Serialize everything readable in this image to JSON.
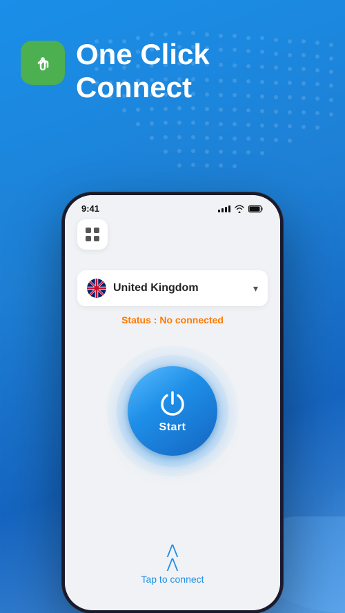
{
  "app": {
    "title": "One Click Connect",
    "title_line1": "One Click",
    "title_line2": "Connect"
  },
  "header": {
    "app_icon_alt": "touch-icon"
  },
  "phone": {
    "status_bar": {
      "time": "9:41"
    },
    "grid_button_label": "menu"
  },
  "country_selector": {
    "country_name": "United Kingdom",
    "chevron": "chevron-down"
  },
  "connection": {
    "status_label": "Status : ",
    "status_value": "No connected",
    "button_label": "Start"
  },
  "tap_to_connect": {
    "label": "Tap to connect"
  }
}
